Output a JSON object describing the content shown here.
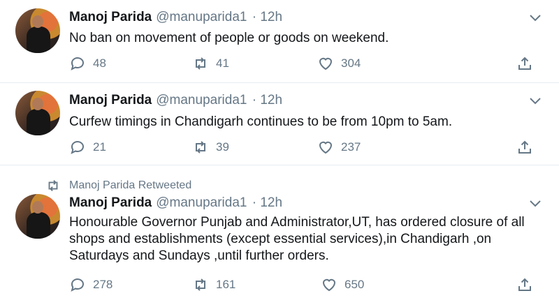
{
  "tweets": [
    {
      "name": "Manoj Parida",
      "handle": "@manuparida1",
      "time": "· 12h",
      "text": "No ban on movement of people or goods on weekend.",
      "replies": "48",
      "retweets": "41",
      "likes": "304"
    },
    {
      "name": "Manoj Parida",
      "handle": "@manuparida1",
      "time": "· 12h",
      "text": "Curfew timings in Chandigarh continues to be from 10pm to 5am.",
      "replies": "21",
      "retweets": "39",
      "likes": "237"
    },
    {
      "retweeted_label": "Manoj Parida Retweeted",
      "name": "Manoj Parida",
      "handle": "@manuparida1",
      "time": "· 12h",
      "text": "Honourable Governor Punjab and Administrator,UT, has ordered closure of all shops and establishments (except essential services),in Chandigarh ,on Saturdays and Sundays ,until further orders.",
      "replies": "278",
      "retweets": "161",
      "likes": "650"
    }
  ]
}
